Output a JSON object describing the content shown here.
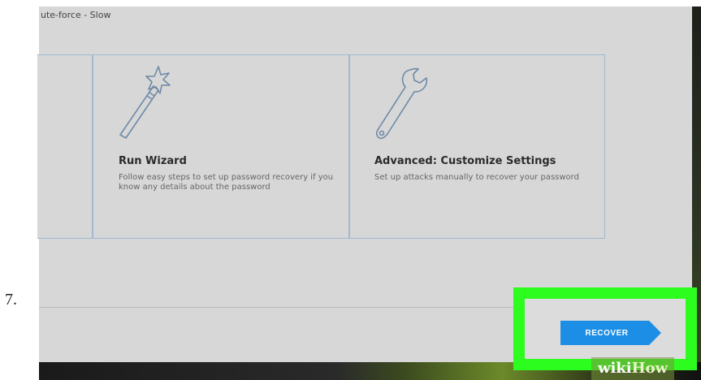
{
  "step": {
    "number": "7."
  },
  "window": {
    "title_fragment": "ute-force - Slow"
  },
  "cards": [
    {
      "icon": "magic-wand-icon",
      "title": "Run Wizard",
      "description": "Follow easy steps to set up password recovery if you know any details about the password"
    },
    {
      "icon": "wrench-icon",
      "title": "Advanced: Customize Settings",
      "description": "Set up attacks manually to recover your password"
    }
  ],
  "footer": {
    "recover_label": "RECOVER"
  },
  "watermark": {
    "wiki": "wiki",
    "how": "How"
  },
  "colors": {
    "window_bg": "#d7d7d7",
    "card_border": "#9fb9d1",
    "button_bg": "#1c8ee6",
    "highlight": "#2dfc1f",
    "icon_stroke": "#6e8aa6"
  }
}
